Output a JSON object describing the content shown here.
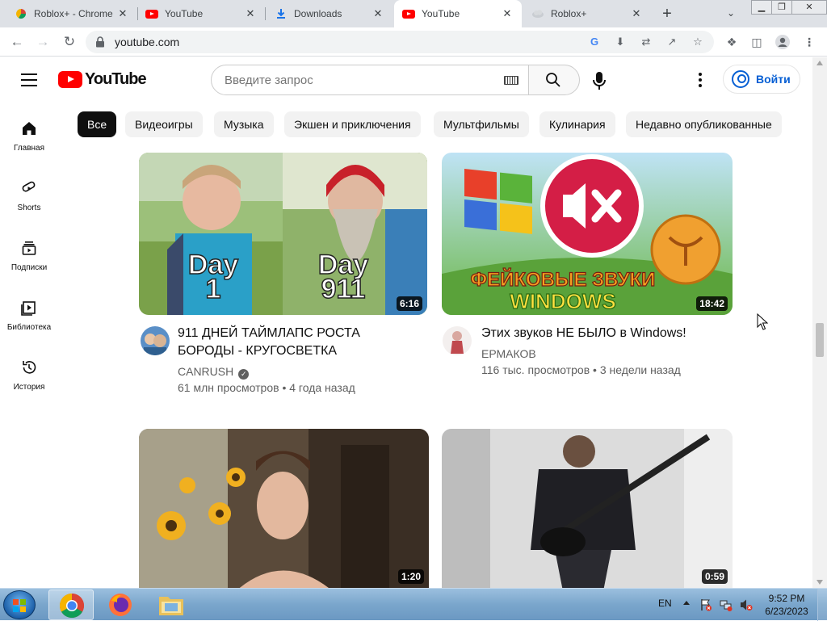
{
  "browser": {
    "tabs": [
      {
        "title": "Roblox+ - Chrome",
        "active": false
      },
      {
        "title": "YouTube",
        "active": false
      },
      {
        "title": "Downloads",
        "active": false
      },
      {
        "title": "YouTube",
        "active": true
      },
      {
        "title": "Roblox+",
        "active": false
      }
    ],
    "url": "youtube.com",
    "window_controls": {
      "minimize": "▁",
      "maximize": "❐",
      "close": "✕"
    }
  },
  "youtube": {
    "logo_text": "YouTube",
    "search": {
      "placeholder": "Введите запрос"
    },
    "sign_in_label": "Войти",
    "guide": [
      {
        "label": "Главная",
        "icon": "home-icon"
      },
      {
        "label": "Shorts",
        "icon": "shorts-icon"
      },
      {
        "label": "Подписки",
        "icon": "subscriptions-icon"
      },
      {
        "label": "Библиотека",
        "icon": "library-icon"
      },
      {
        "label": "История",
        "icon": "history-icon"
      }
    ],
    "chips": [
      {
        "label": "Все",
        "active": true
      },
      {
        "label": "Видеоигры",
        "active": false
      },
      {
        "label": "Музыка",
        "active": false
      },
      {
        "label": "Экшен и приключения",
        "active": false
      },
      {
        "label": "Мультфильмы",
        "active": false
      },
      {
        "label": "Кулинария",
        "active": false
      },
      {
        "label": "Недавно опубликованные",
        "active": false
      }
    ],
    "videos": [
      {
        "title_line1": "911 ДНЕЙ ТАЙМЛАПС РОСТА",
        "title_line2": "БОРОДЫ - КРУГОСВЕТКА",
        "channel": "CANRUSH",
        "verified": true,
        "views": "61 млн просмотров",
        "age": "4 года назад",
        "meta": "61 млн просмотров • 4 года назад",
        "duration": "6:16",
        "overlay_left": [
          "Day",
          "1"
        ],
        "overlay_right": [
          "Day",
          "911"
        ]
      },
      {
        "title_line1": "Этих звуков НЕ БЫЛО в Windows!",
        "channel": "ЕРМАКОВ",
        "meta": "116 тыс. просмотров • 3 недели назад",
        "duration": "18:42",
        "overlay_line1": "ФЕЙКОВЫЕ ЗВУКИ",
        "overlay_line2": "WINDOWS"
      },
      {
        "duration": "1:20"
      },
      {
        "duration": "0:59"
      }
    ]
  },
  "taskbar": {
    "language": "EN",
    "time": "9:52 PM",
    "date": "6/23/2023"
  }
}
